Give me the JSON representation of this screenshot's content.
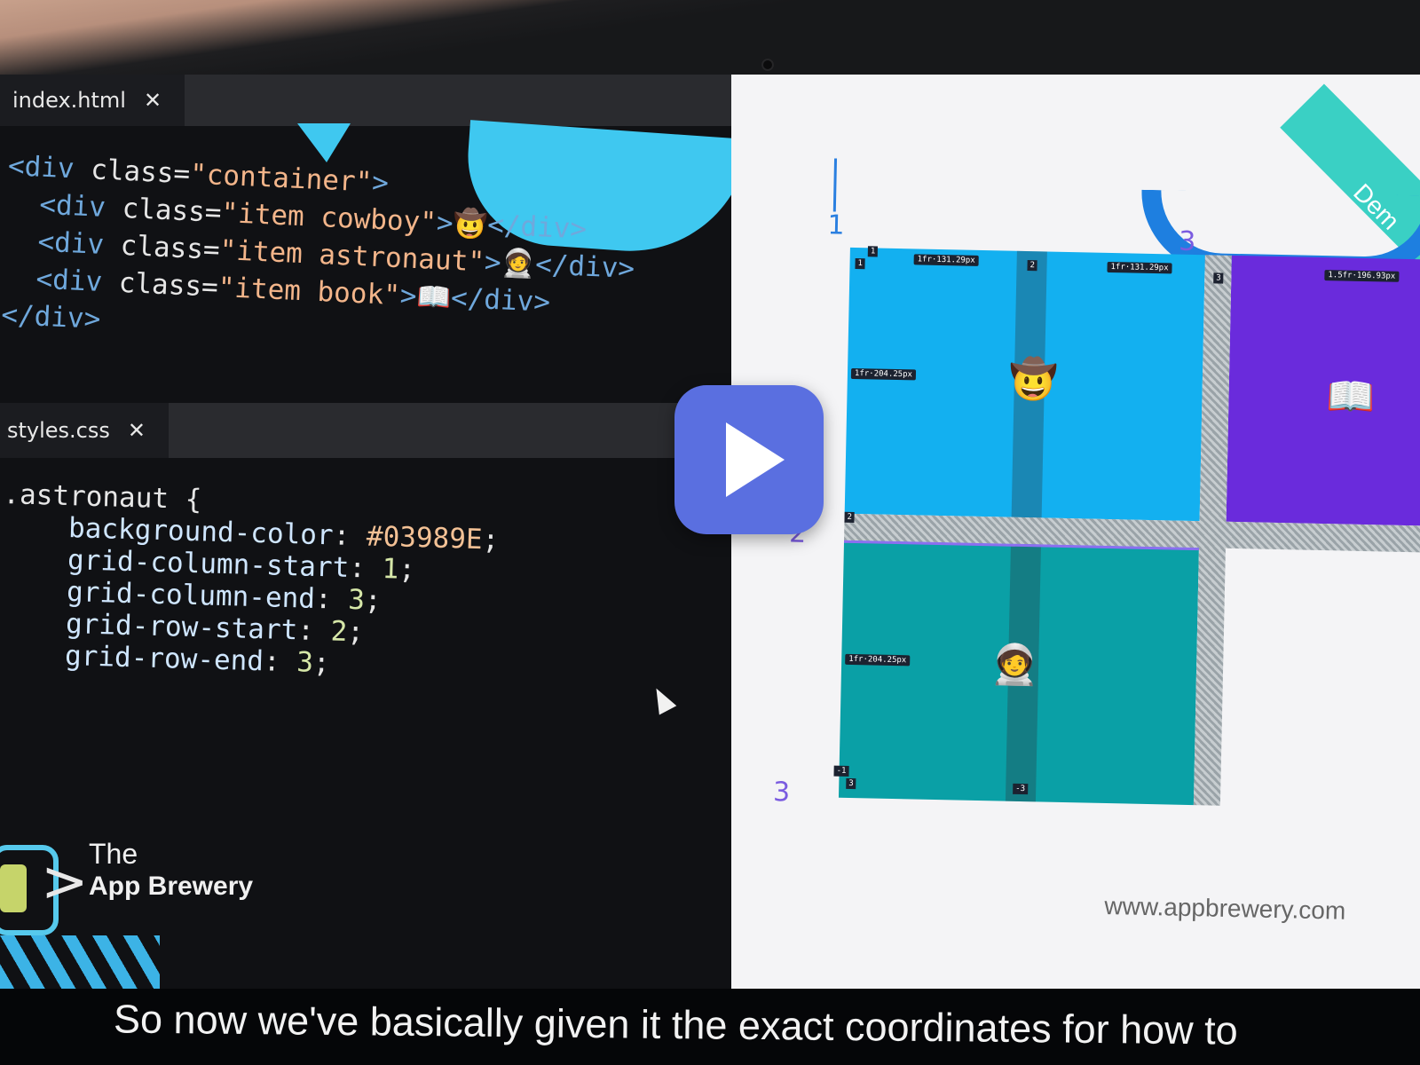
{
  "tabs": {
    "html_tab": {
      "label": "index.html",
      "close": "✕"
    },
    "css_tab": {
      "label": "styles.css",
      "close": "✕"
    }
  },
  "html_code": {
    "line1": {
      "open": "<div",
      "attr": " class=",
      "val": "\"container\"",
      "close": ">"
    },
    "line2": {
      "open": "<div",
      "attr": " class=",
      "val": "\"item cowboy\"",
      "close": ">",
      "emoji": "🤠",
      "end": "</div>"
    },
    "line3": {
      "open": "<div",
      "attr": " class=",
      "val": "\"item astronaut\"",
      "close": ">",
      "emoji": "🧑‍🚀",
      "end": "</div>"
    },
    "line4": {
      "open": "<div",
      "attr": " class=",
      "val": "\"item book\"",
      "close": ">",
      "emoji": "📖",
      "end": "</div>"
    },
    "line5": "</div>"
  },
  "css_code": {
    "selector": ".astronaut {",
    "rules": [
      {
        "prop": "background-color",
        "value": "#03989E"
      },
      {
        "prop": "grid-column-start",
        "value": "1"
      },
      {
        "prop": "grid-column-end",
        "value": "3"
      },
      {
        "prop": "grid-row-start",
        "value": "2"
      },
      {
        "prop": "grid-row-end",
        "value": "3"
      }
    ]
  },
  "logo": {
    "line1": "The",
    "line2": "App Brewery"
  },
  "preview": {
    "ribbon_text": "Dem",
    "url": "www.appbrewery.com",
    "emojis": {
      "cowboy": "🤠",
      "astronaut": "🧑‍🚀",
      "book": "📖"
    },
    "chips": {
      "col1": "1fr·131.29px",
      "col2": "1fr·131.29px",
      "col3": "1.5fr·196.93px",
      "row1": "1fr·204.25px",
      "row2": "1fr·204.25px"
    },
    "line_numbers": {
      "top1": "1",
      "top2": "2",
      "top3": "3",
      "left1": "1",
      "left2": "2",
      "left3": "3",
      "neg1": "-1",
      "neg2": "-3"
    },
    "handwritten": {
      "m1": "1",
      "m2": "2",
      "m3": "3",
      "m4": "3"
    }
  },
  "subtitle": "So now we've basically given it the exact coordinates for how to",
  "colors": {
    "cowboy_cell": "#13b0f0",
    "book_cell": "#6a2bdc",
    "astronaut_cell": "#03989E",
    "play_button": "#5a6fe0"
  },
  "icons": [
    "close-icon",
    "play-icon",
    "mouse-pointer-icon",
    "app-brewery-logo-icon"
  ]
}
